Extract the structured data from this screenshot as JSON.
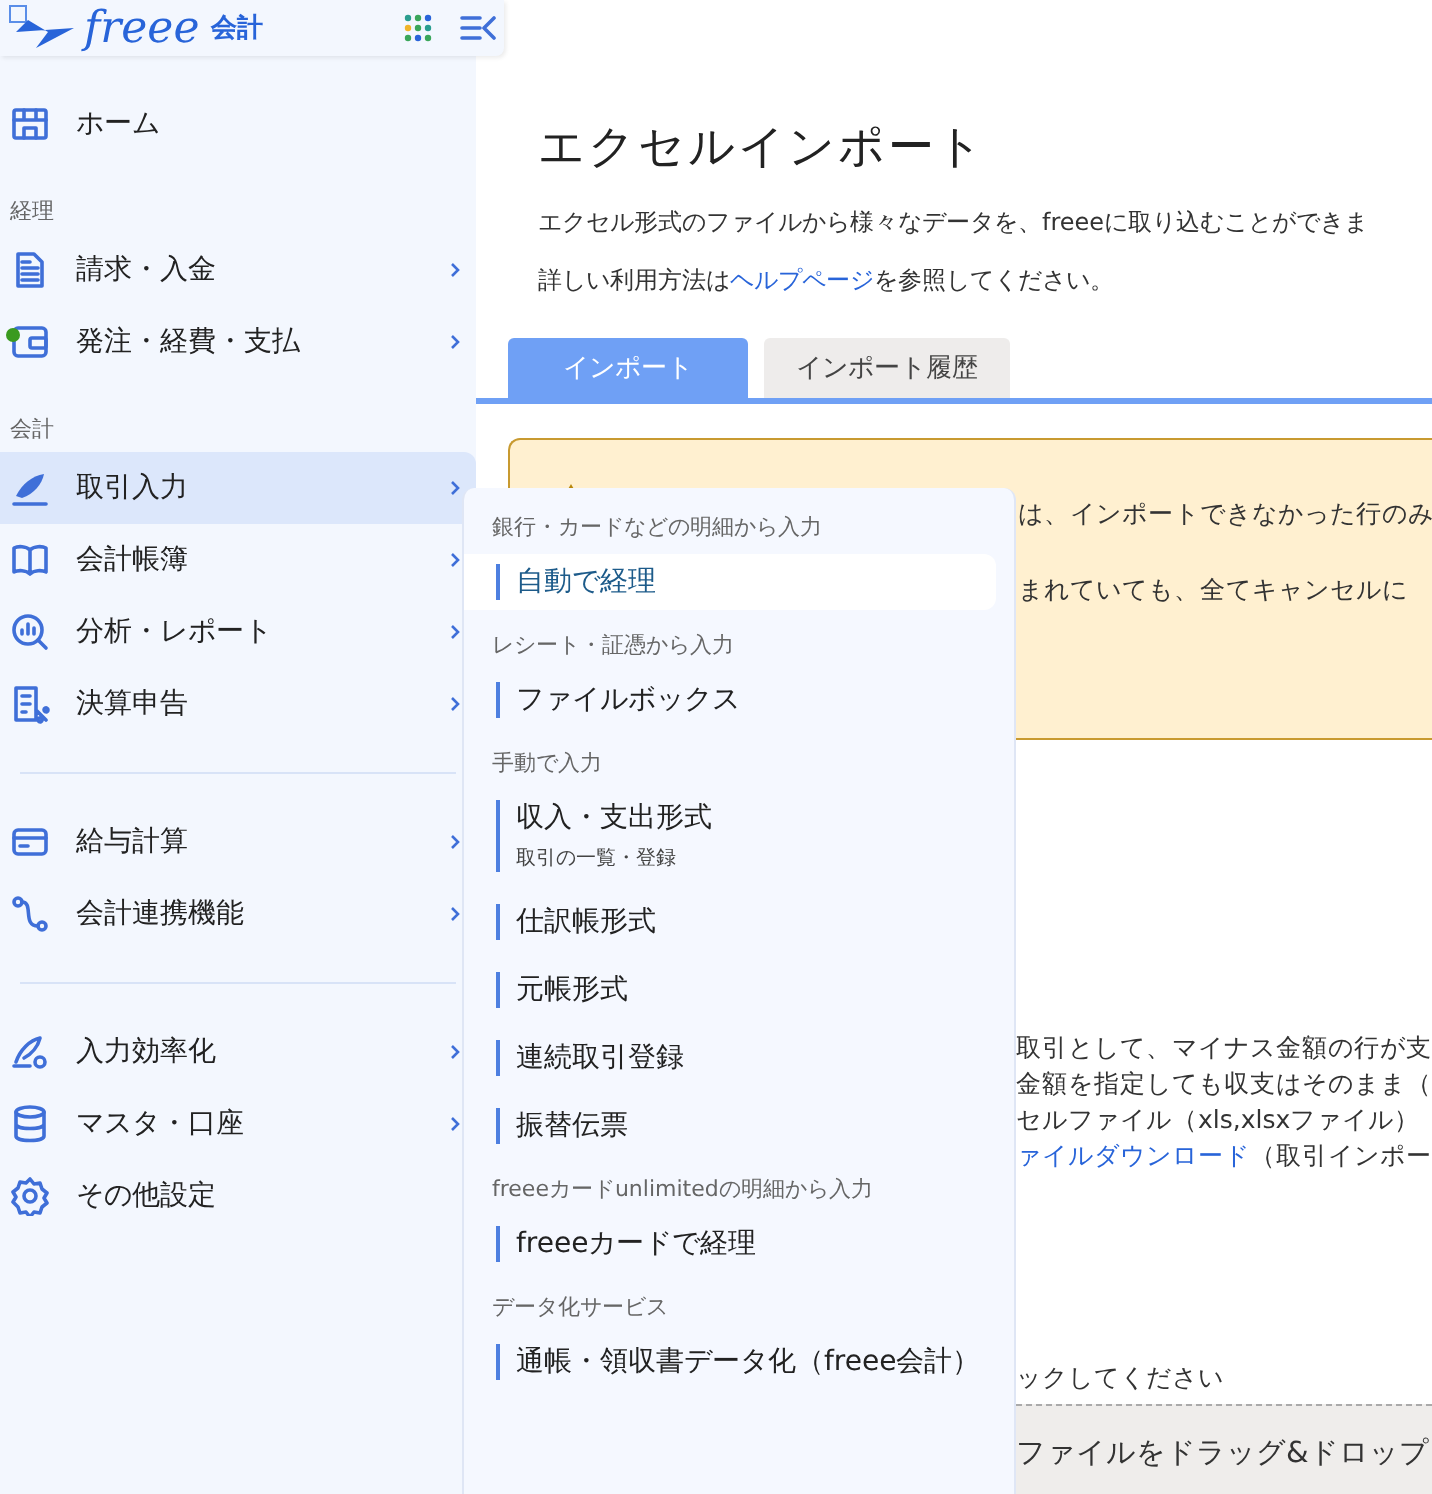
{
  "sidebar": {
    "logo": "freee",
    "product": "会計",
    "groups": [
      {
        "items": [
          {
            "kind": "home",
            "label": "ホーム",
            "selected": false,
            "submenu": false,
            "notification": false
          }
        ]
      },
      {
        "heading": "経理",
        "items": [
          {
            "kind": "document",
            "label": "請求・入金",
            "selected": false,
            "submenu": true,
            "notification": false
          },
          {
            "kind": "wallet",
            "label": "発注・経費・支払",
            "selected": false,
            "submenu": true,
            "notification": true
          }
        ]
      },
      {
        "heading": "会計",
        "items": [
          {
            "kind": "pen",
            "label": "取引入力",
            "selected": true,
            "submenu": true,
            "notification": false
          },
          {
            "kind": "book",
            "label": "会計帳簿",
            "selected": false,
            "submenu": true,
            "notification": false
          },
          {
            "kind": "analysis",
            "label": "分析・レポート",
            "selected": false,
            "submenu": true,
            "notification": false
          },
          {
            "kind": "tax",
            "label": "決算申告",
            "selected": false,
            "submenu": true,
            "notification": false
          }
        ]
      },
      {
        "items": [
          {
            "kind": "card",
            "label": "給与計算",
            "selected": false,
            "submenu": true,
            "notification": false
          },
          {
            "kind": "link",
            "label": "会計連携機能",
            "selected": false,
            "submenu": true,
            "notification": false
          }
        ]
      },
      {
        "items": [
          {
            "kind": "efficiency",
            "label": "入力効率化",
            "selected": false,
            "submenu": true,
            "notification": false
          },
          {
            "kind": "database",
            "label": "マスタ・口座",
            "selected": false,
            "submenu": true,
            "notification": false
          },
          {
            "kind": "gear",
            "label": "その他設定",
            "selected": false,
            "submenu": false,
            "notification": false
          }
        ]
      }
    ]
  },
  "main": {
    "title": "エクセルインポート",
    "description": "エクセル形式のファイルから様々なデータを、freeeに取り込むことができま",
    "help": {
      "before": "詳しい利用方法は",
      "link": "ヘルプページ",
      "after": "を参照してください。"
    },
    "tabs": [
      {
        "label": "インポート",
        "selected": true
      },
      {
        "label": "インポート履歴",
        "selected": false
      }
    ],
    "warning_lines": [
      "は、インポートできなかった行のみ",
      "まれていても、全てキャンセルに"
    ],
    "notes": [
      "取引として、マイナス金額の行が支",
      "金額を指定しても収支はそのまま（",
      "セルファイル（xls,xlsxファイル）"
    ],
    "download": {
      "link": "ァイルダウンロード",
      "after": "（取引インポー"
    },
    "drop_hint": "ックしてください",
    "drop_zone": "ファイルをドラッグ&ドロップ"
  },
  "menu": {
    "sections": [
      {
        "heading": "銀行・カードなどの明細から入力",
        "items": [
          {
            "label": "自動で経理",
            "selected": true
          }
        ]
      },
      {
        "heading": "レシート・証憑から入力",
        "items": [
          {
            "label": "ファイルボックス",
            "selected": false
          }
        ]
      },
      {
        "heading": "手動で入力",
        "items": [
          {
            "label": "収入・支出形式",
            "sub": "取引の一覧・登録",
            "selected": false
          },
          {
            "label": "仕訳帳形式",
            "selected": false
          },
          {
            "label": "元帳形式",
            "selected": false
          },
          {
            "label": "連続取引登録",
            "selected": false
          },
          {
            "label": "振替伝票",
            "selected": false
          }
        ]
      },
      {
        "heading": "freeeカードunlimitedの明細から入力",
        "items": [
          {
            "label": "freeeカードで経理",
            "selected": false
          }
        ]
      },
      {
        "heading": "データ化サービス",
        "items": [
          {
            "label": "通帳・領収書データ化（freee会計）",
            "selected": false
          }
        ]
      }
    ]
  }
}
